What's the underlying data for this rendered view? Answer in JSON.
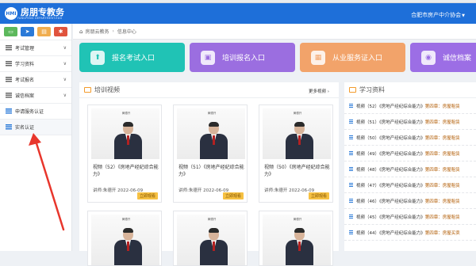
{
  "header": {
    "logo_badge": "HMI",
    "logo_text": "房朋专教务",
    "logo_sub": "FANGPENG DEPARTMENT.EDU",
    "org": "合肥市房产中介协会"
  },
  "sidebar": {
    "icons": [
      {
        "name": "monitor-icon",
        "glyph": "▭",
        "color": "#5cb85c"
      },
      {
        "name": "send-icon",
        "glyph": "➤",
        "color": "#2a7ad8"
      },
      {
        "name": "doc-icon",
        "glyph": "▤",
        "color": "#f0ad4e"
      },
      {
        "name": "gear-icon",
        "glyph": "✱",
        "color": "#e0533d"
      }
    ],
    "items": [
      {
        "label": "考试管理",
        "chevron": "∨"
      },
      {
        "label": "学习资料",
        "chevron": "∨"
      },
      {
        "label": "考试报名",
        "chevron": "∨"
      },
      {
        "label": "诚信档案",
        "chevron": "∨"
      },
      {
        "label": "申请服务认证",
        "chevron": ""
      },
      {
        "label": "实名认证",
        "chevron": ""
      }
    ]
  },
  "breadcrumb": {
    "home": "房朋云教务",
    "current": "信息中心"
  },
  "quick_cards": [
    {
      "label": "报名考试入口",
      "color": "#20c3b5",
      "icon": "⬆"
    },
    {
      "label": "培训报名入口",
      "color": "#9b6ee0",
      "icon": "▣"
    },
    {
      "label": "从业服务证入口",
      "color": "#f2a36a",
      "icon": "▦"
    },
    {
      "label": "诚信档案",
      "color": "#9c6ee5",
      "icon": "◉"
    }
  ],
  "videos": {
    "title": "培训视频",
    "more": "更多视频 ›",
    "board_title": "黄德开",
    "items": [
      {
        "title": "视频（52）《房地产经纪综合能力》",
        "meta": "讲师:朱德开 2022-06-09",
        "button": "立即观看"
      },
      {
        "title": "视频（51）《房地产经纪综合能力》",
        "meta": "讲师:朱德开 2022-06-09",
        "button": "立即观看"
      },
      {
        "title": "视频（50）《房地产经纪综合能力》",
        "meta": "讲师:朱德开 2022-06-09",
        "button": "立即观看"
      }
    ]
  },
  "study": {
    "title": "学习资料",
    "items": [
      {
        "prefix": "视频（52）《房地产经纪综合能力》",
        "suffix": "第四章：房屋租赁"
      },
      {
        "prefix": "视频（51）《房地产经纪综合能力》",
        "suffix": "第四章：房屋租赁"
      },
      {
        "prefix": "视频（50）《房地产经纪综合能力》",
        "suffix": "第四章：房屋租赁"
      },
      {
        "prefix": "视频（49）《房地产经纪综合能力》",
        "suffix": "第四章：房屋租赁"
      },
      {
        "prefix": "视频（48）《房地产经纪综合能力》",
        "suffix": "第四章：房屋租赁"
      },
      {
        "prefix": "视频（47）《房地产经纪综合能力》",
        "suffix": "第四章：房屋租赁"
      },
      {
        "prefix": "视频（46）《房地产经纪综合能力》",
        "suffix": "第四章：房屋租赁"
      },
      {
        "prefix": "视频（45）《房地产经纪综合能力》",
        "suffix": "第四章：房屋租赁"
      },
      {
        "prefix": "视频（44）《房地产经纪综合能力》",
        "suffix": "第四章：房屋买卖"
      }
    ]
  }
}
